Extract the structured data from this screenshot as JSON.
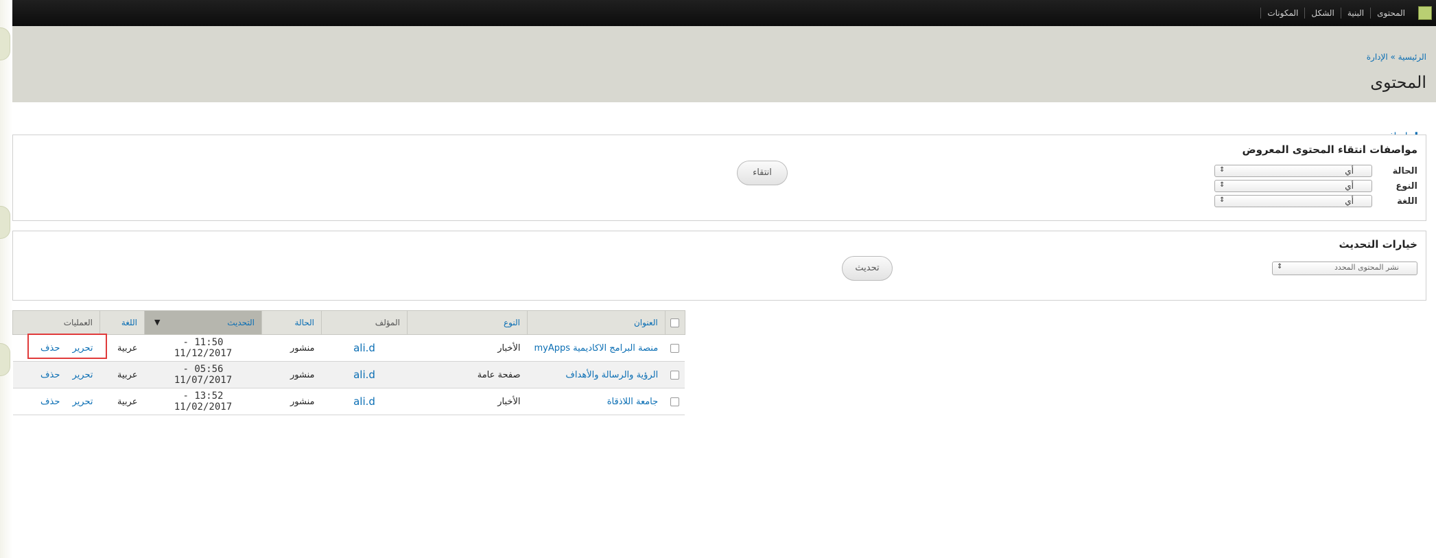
{
  "toolbar": {
    "items": [
      "المحتوى",
      "البنية",
      "الشكل",
      "المكونات"
    ]
  },
  "header": {
    "breadcrumb": "الرئيسية » الإدارة",
    "title": "المحتوى"
  },
  "actions": {
    "add_content": "إضافة محتوى"
  },
  "filters": {
    "title": "مواصفات انتقاء المحتوى المعروض",
    "status_label": "الحالة",
    "type_label": "النوع",
    "language_label": "اللغة",
    "status_value": "أي",
    "type_value": "أي",
    "language_value": "أي",
    "filter_button": "انتقاء"
  },
  "update": {
    "title": "خيارات التحديث",
    "select_value": "نشر المحتوى المحدد",
    "update_button": "تحديث"
  },
  "table": {
    "headers": {
      "title": "العنوان",
      "type": "النوع",
      "author": "المؤلف",
      "status": "الحالة",
      "updated": "التحديث",
      "language": "اللغة",
      "operations": "العمليات"
    },
    "rows": [
      {
        "title": "منصة البرامج الاكاديمية myApps",
        "type": "الأخبار",
        "author": "ali.d",
        "status": "منشور",
        "updated": "11:50 - 11/12/2017",
        "language": "عربية",
        "edit": "تحرير",
        "delete": "حذف"
      },
      {
        "title": "الرؤية والرسالة والأهداف",
        "type": "صفحة عامة",
        "author": "ali.d",
        "status": "منشور",
        "updated": "05:56 - 11/07/2017",
        "language": "عربية",
        "edit": "تحرير",
        "delete": "حذف"
      },
      {
        "title": "جامعة اللاذقاة",
        "type": "الأخبار",
        "author": "ali.d",
        "status": "منشور",
        "updated": "13:52 - 11/02/2017",
        "language": "عربية",
        "edit": "تحرير",
        "delete": "حذف"
      }
    ]
  },
  "icons": {
    "sort": "sort-descending-icon",
    "add": "plus-icon",
    "home": "home-icon"
  },
  "colors": {
    "link": "#0a6eb4",
    "header_bg": "#d8d8d0",
    "toolbar_bg": "#111111",
    "highlight": "#e03a3a"
  }
}
